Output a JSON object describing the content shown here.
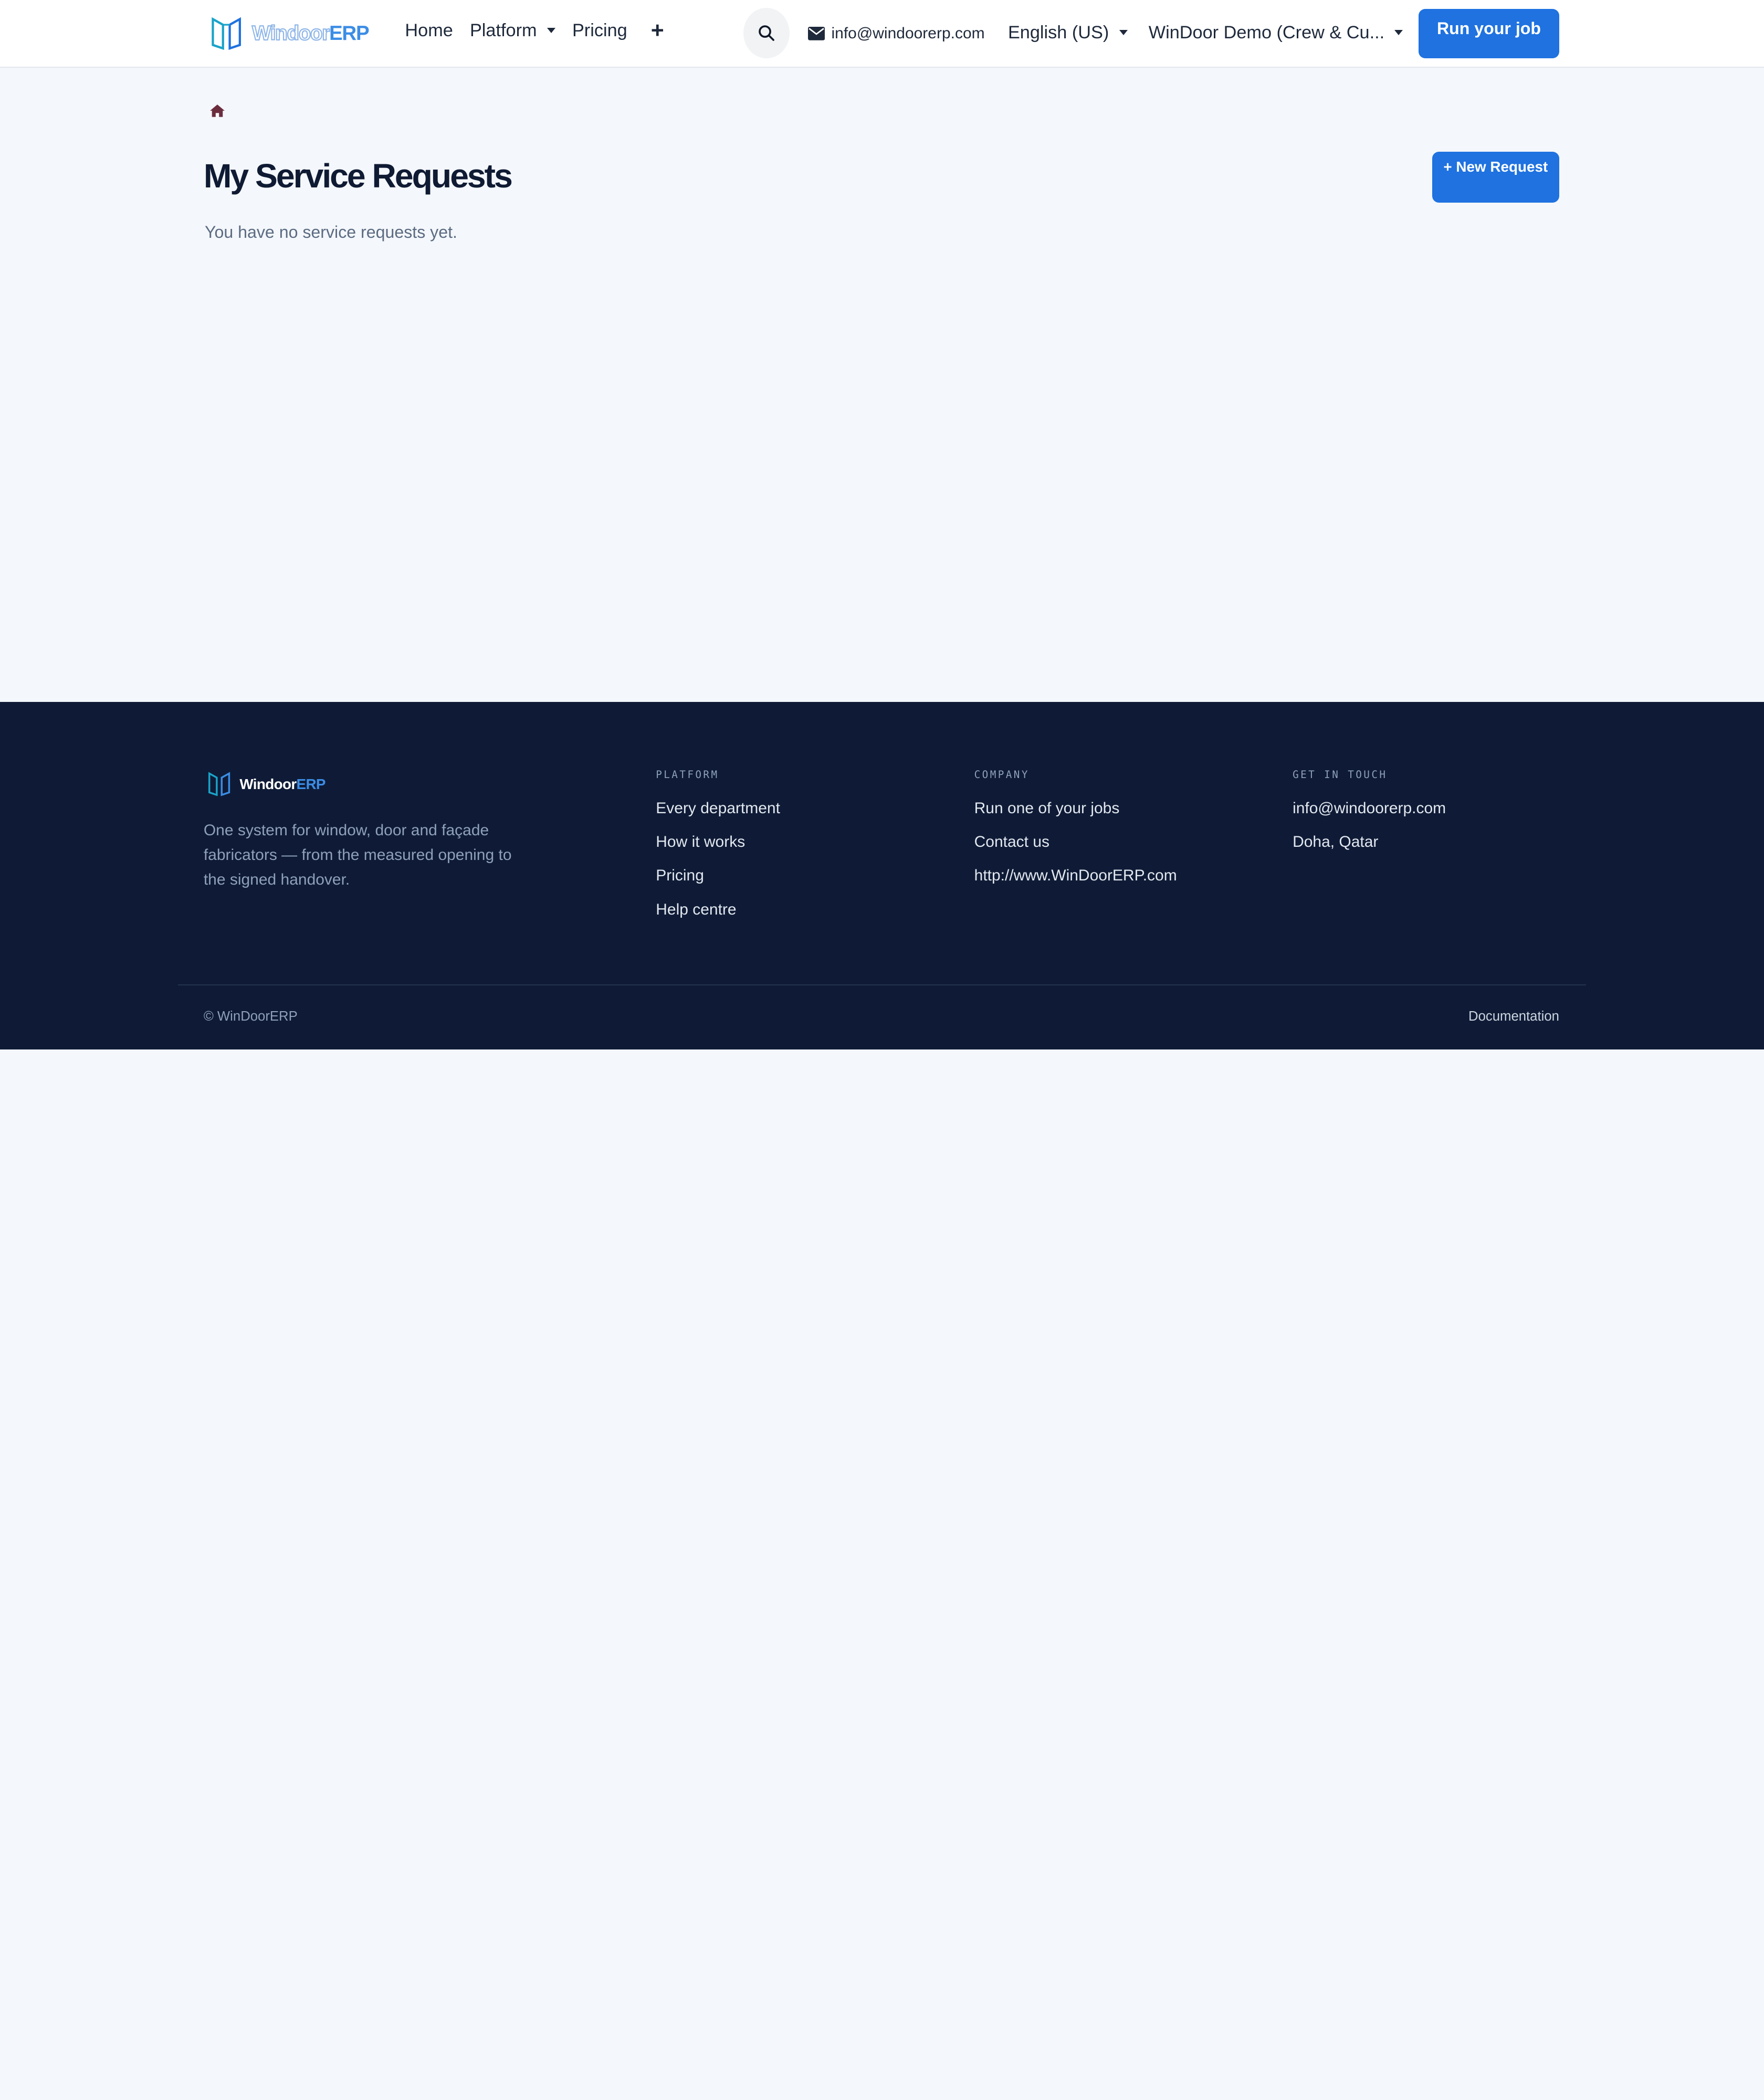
{
  "header": {
    "logo": {
      "part1": "Windoor",
      "part2": "ERP"
    },
    "nav": {
      "home": "Home",
      "platform": "Platform",
      "pricing": "Pricing",
      "more": "+"
    },
    "search_icon": "search-icon",
    "email": "info@windoorerp.com",
    "language": "English (US)",
    "account": "WinDoor Demo (Crew & Cu...",
    "cta": "Run your job"
  },
  "main": {
    "breadcrumb_icon": "home-icon",
    "title": "My Service Requests",
    "new_button": "+ New Request",
    "empty_message": "You have no service requests yet."
  },
  "footer": {
    "logo": {
      "part1": "Windoor",
      "part2": "ERP"
    },
    "tagline": "One system for window, door and façade fabricators — from the measured opening to the signed handover.",
    "columns": [
      {
        "heading": "PLATFORM",
        "links": [
          "Every department",
          "How it works",
          "Pricing",
          "Help centre"
        ]
      },
      {
        "heading": "COMPANY",
        "links": [
          "Run one of your jobs",
          "Contact us",
          "http://www.WinDoorERP.com"
        ]
      },
      {
        "heading": "GET IN TOUCH",
        "links": [
          "info@windoorerp.com",
          "Doha, Qatar"
        ]
      }
    ],
    "copyright": "© WinDoorERP",
    "documentation": "Documentation"
  },
  "colors": {
    "primary": "#1f72e0",
    "footer_bg": "#0f1b36",
    "page_bg": "#f4f7fb",
    "logo_accent": "#3b8de6",
    "home_icon": "#6b2d3e"
  }
}
